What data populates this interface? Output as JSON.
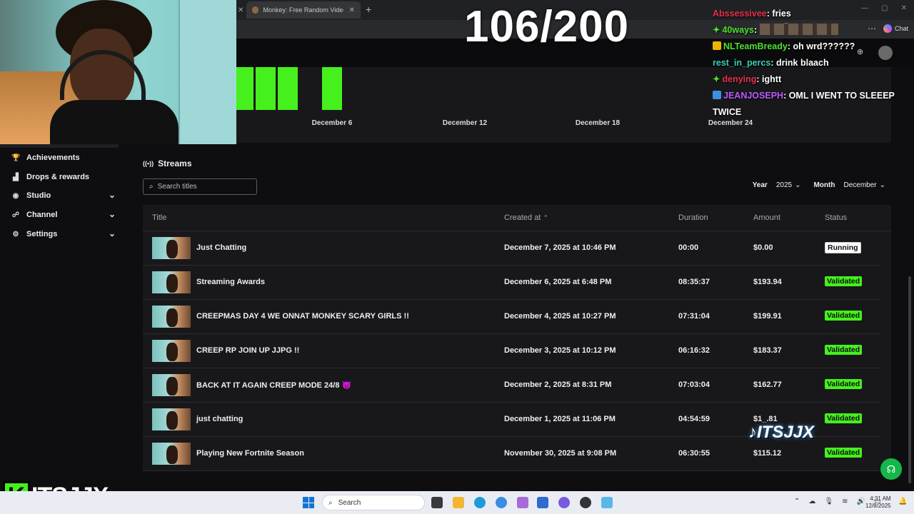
{
  "browser": {
    "tab_title": "Monkey: Free Random Video Chat",
    "new_tab_icon": "+",
    "chat_label": "Chat"
  },
  "overlay": {
    "counter": "106/200",
    "brand_badge": "ITSJJX",
    "logo_text": "ITSJJX"
  },
  "chat_messages": [
    {
      "user": "Abssessivee",
      "text": "fries",
      "user_color": "#e8304a",
      "badge": "none"
    },
    {
      "user": "40ways",
      "text": "",
      "user_color": "#4fe02c",
      "badge": "star"
    },
    {
      "user": "NLTeamBready",
      "text": "oh wrd??????",
      "user_color": "#4fe02c",
      "badge": "crown"
    },
    {
      "user": "rest_in_percs",
      "text": "drink blaach",
      "user_color": "#3ad0b5",
      "badge": "none"
    },
    {
      "user": "denying",
      "text": "ightt",
      "user_color": "#e8304a",
      "badge": "star"
    },
    {
      "user": "JEANJOSEPH",
      "text": "OML I WENT TO SLEEEP TWICE",
      "user_color": "#b95cff",
      "badge": "bits"
    }
  ],
  "chart_data": {
    "type": "bar",
    "x_tick_labels": [
      "December 6",
      "December 12",
      "December 18",
      "December 24"
    ],
    "bar_color": "#45f01d",
    "bars": [
      {
        "day": "December 2",
        "value": 1
      },
      {
        "day": "December 3",
        "value": 1
      },
      {
        "day": "December 4",
        "value": 1
      },
      {
        "day": "December 6",
        "value": 1
      }
    ]
  },
  "sidebar": {
    "items": [
      {
        "label": "Achievements",
        "icon": "trophy-icon",
        "has_chevron": false
      },
      {
        "label": "Drops & rewards",
        "icon": "gift-icon",
        "has_chevron": false
      },
      {
        "label": "Studio",
        "icon": "studio-icon",
        "has_chevron": true
      },
      {
        "label": "Channel",
        "icon": "channel-icon",
        "has_chevron": true
      },
      {
        "label": "Settings",
        "icon": "gear-icon",
        "has_chevron": true
      }
    ]
  },
  "streams": {
    "title": "Streams",
    "search_placeholder": "Search titles",
    "year_label": "Year",
    "year_value": "2025",
    "month_label": "Month",
    "month_value": "December",
    "columns": {
      "title": "Title",
      "created_at": "Created at",
      "duration": "Duration",
      "amount": "Amount",
      "status": "Status"
    },
    "rows": [
      {
        "title": "Just Chatting",
        "created_at": "December 7, 2025 at 10:46 PM",
        "duration": "00:00",
        "amount": "$0.00",
        "status": "Running"
      },
      {
        "title": "Streaming Awards",
        "created_at": "December 6, 2025 at 6:48 PM",
        "duration": "08:35:37",
        "amount": "$193.94",
        "status": "Validated"
      },
      {
        "title": "CREEPMAS DAY 4 WE ONNAT MONKEY SCARY GIRLS !!",
        "created_at": "December 4, 2025 at 10:27 PM",
        "duration": "07:31:04",
        "amount": "$199.91",
        "status": "Validated"
      },
      {
        "title": "CREEP RP JOIN UP JJPG !!",
        "created_at": "December 3, 2025 at 10:12 PM",
        "duration": "06:16:32",
        "amount": "$183.37",
        "status": "Validated"
      },
      {
        "title": "BACK AT IT AGAIN CREEP MODE 24/8 👿",
        "created_at": "December 2, 2025 at 8:31 PM",
        "duration": "07:03:04",
        "amount": "$162.77",
        "status": "Validated"
      },
      {
        "title": "just chatting",
        "created_at": "December 1, 2025 at 11:06 PM",
        "duration": "04:54:59",
        "amount": "$1_.81",
        "status": "Validated"
      },
      {
        "title": "Playing New Fortnite Season",
        "created_at": "November 30, 2025 at 9:08 PM",
        "duration": "06:30:55",
        "amount": "$115.12",
        "status": "Validated"
      }
    ]
  },
  "taskbar": {
    "search_label": "Search",
    "time": "4:31 AM",
    "date": "12/8/2025"
  }
}
